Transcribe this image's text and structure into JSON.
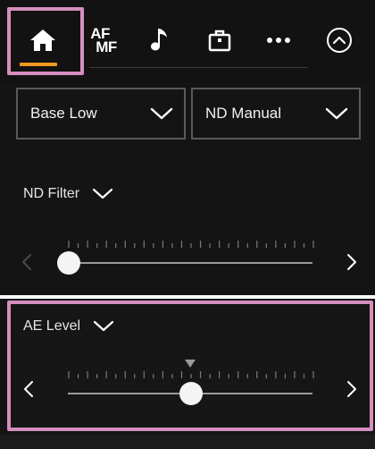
{
  "tabs": [
    {
      "name": "home",
      "icon": "home-icon",
      "selected": true
    },
    {
      "name": "af-mf",
      "icon": "af-mf-icon",
      "top_label": "AF",
      "bottom_label": "MF"
    },
    {
      "name": "audio",
      "icon": "music-note-icon"
    },
    {
      "name": "camera",
      "icon": "camera-body-icon"
    },
    {
      "name": "more",
      "icon": "more-dots-icon"
    },
    {
      "name": "collapse",
      "icon": "chevron-up-circle-icon"
    }
  ],
  "dropdowns": {
    "base": {
      "value": "Base Low"
    },
    "nd_mode": {
      "value": "ND Manual"
    }
  },
  "nd_filter": {
    "label": "ND Filter",
    "level_fraction": 0.0
  },
  "ae_level": {
    "label": "AE Level",
    "level_fraction": 0.5,
    "default_marker_fraction": 0.5
  },
  "colors": {
    "background": "#141414",
    "accent_underline": "#f39a1e",
    "highlight_frame": "#d58fbf",
    "knob": "#f4f4f4"
  }
}
